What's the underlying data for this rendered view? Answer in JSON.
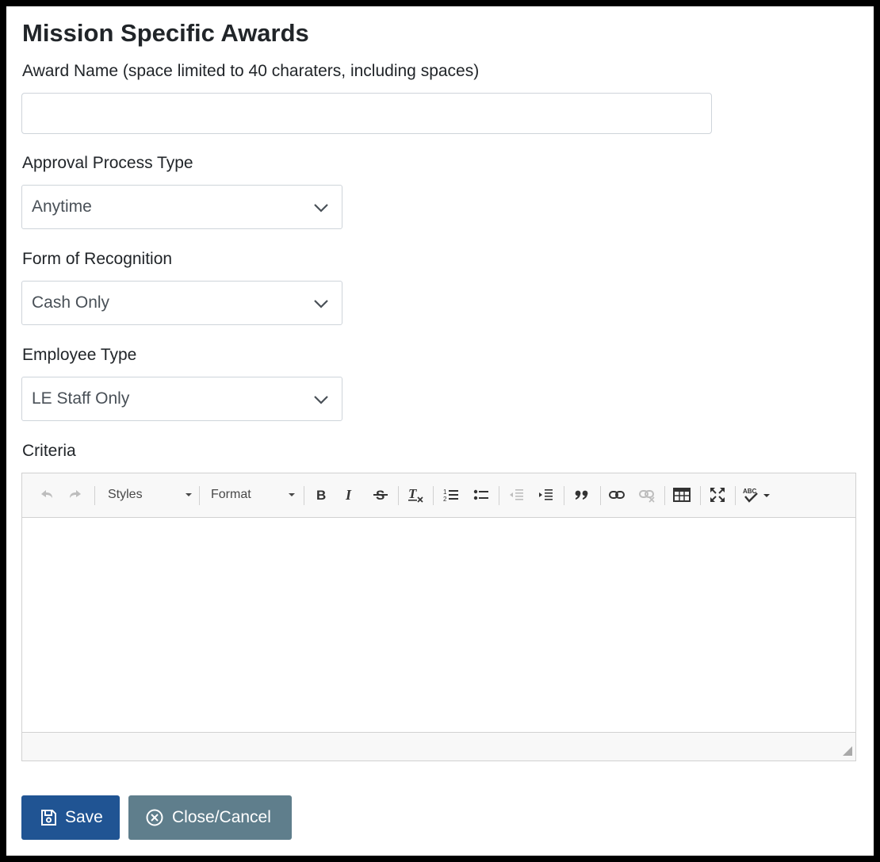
{
  "form": {
    "title": "Mission Specific Awards",
    "award_name": {
      "label": "Award Name (space limited to 40 charaters, including spaces)",
      "value": ""
    },
    "approval_process": {
      "label": "Approval Process Type",
      "value": "Anytime"
    },
    "form_of_recognition": {
      "label": "Form of Recognition",
      "value": "Cash Only"
    },
    "employee_type": {
      "label": "Employee Type",
      "value": "LE Staff Only"
    },
    "criteria": {
      "label": "Criteria"
    }
  },
  "editor": {
    "styles_label": "Styles",
    "format_label": "Format",
    "toolbar_icons": [
      "undo-icon",
      "redo-icon",
      "bold-icon",
      "italic-icon",
      "strikethrough-icon",
      "remove-format-icon",
      "numbered-list-icon",
      "bulleted-list-icon",
      "outdent-icon",
      "indent-icon",
      "blockquote-icon",
      "link-icon",
      "unlink-icon",
      "table-icon",
      "maximize-icon",
      "spellcheck-icon"
    ]
  },
  "actions": {
    "save_label": "Save",
    "cancel_label": "Close/Cancel"
  },
  "colors": {
    "save_button": "#205493",
    "cancel_button": "#5f7e8c",
    "frame": "#000000"
  }
}
